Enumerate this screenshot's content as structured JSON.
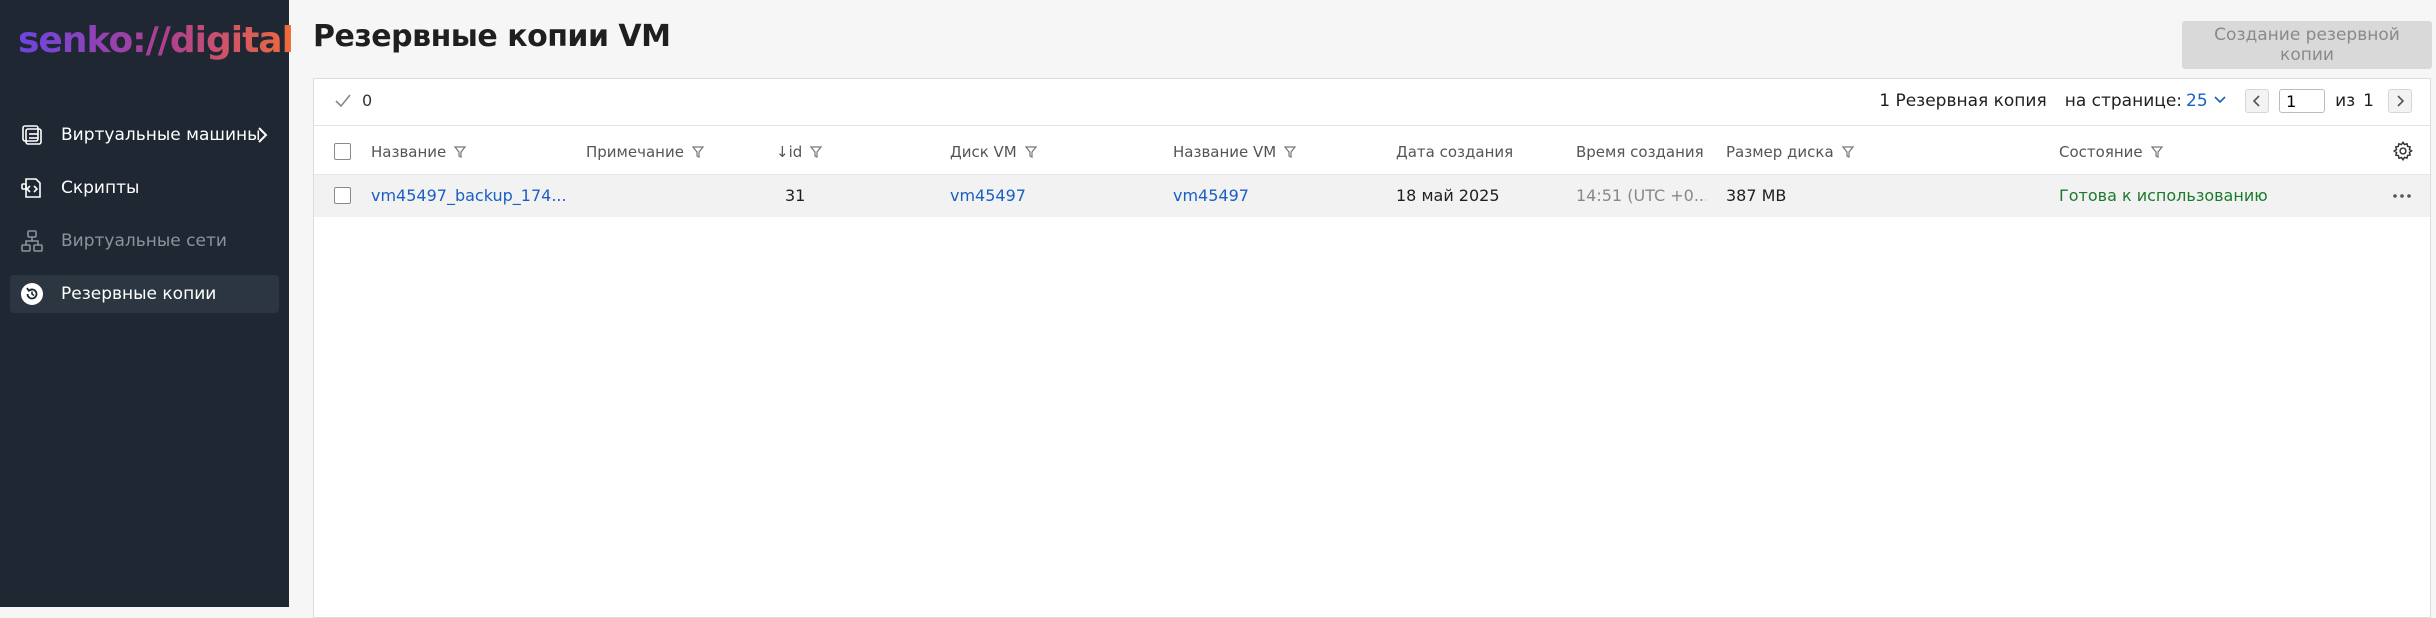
{
  "brand": {
    "logo": "senko://digital"
  },
  "sidebar": {
    "items": [
      {
        "label": "Виртуальные машины",
        "icon": "virtual-machines-icon"
      },
      {
        "label": "Скрипты",
        "icon": "scripts-icon"
      },
      {
        "label": "Виртуальные сети",
        "icon": "network-icon"
      },
      {
        "label": "Резервные копии",
        "icon": "backup-icon"
      }
    ]
  },
  "header": {
    "title": "Резервные копии VM",
    "create_button": "Создание резервной копии"
  },
  "toolbar": {
    "selected_count": "0",
    "total_label": "1 Резервная копия",
    "per_page_label": "на странице:",
    "per_page_value": "25",
    "page_input": "1",
    "page_of_label": "из",
    "page_total": "1"
  },
  "table": {
    "columns": [
      "Название",
      "Примечание",
      "↓id",
      "Диск VM",
      "Название VM",
      "Дата создания",
      "Время создания",
      "Размер диска",
      "Состояние"
    ],
    "rows": [
      {
        "name": "vm45497_backup_174...",
        "note": "",
        "id": "31",
        "disk": "vm45497",
        "vm_name": "vm45497",
        "created_date": "18 май 2025",
        "created_time": "14:51 (UTC +0...",
        "disk_size": "387 MB",
        "status": "Готова к использованию"
      }
    ]
  },
  "colors": {
    "sidebar_bg": "#1e2732",
    "link": "#1a5fc4",
    "status_ok": "#1b7a2c"
  }
}
